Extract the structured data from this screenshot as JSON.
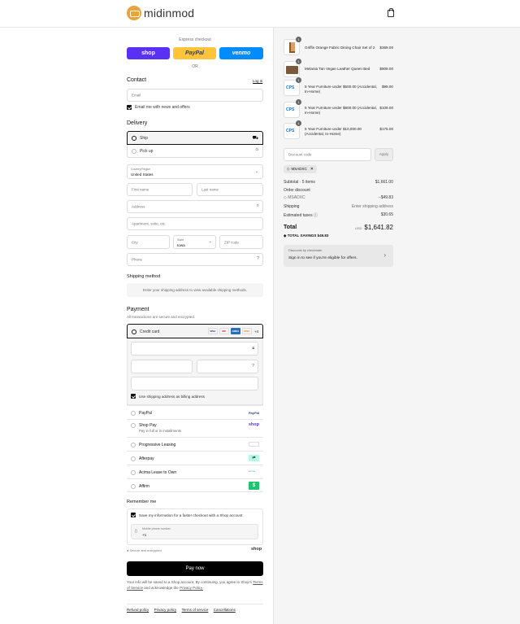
{
  "header": {
    "brand": "midinmod"
  },
  "express": {
    "label": "Express checkout",
    "shop": "shop",
    "paypal": "PayPal",
    "venmo": "venmo",
    "or": "OR"
  },
  "contact": {
    "title": "Contact",
    "login": "Log in",
    "email_placeholder": "Email",
    "news_label": "Email me with news and offers"
  },
  "delivery": {
    "title": "Delivery",
    "ship": "Ship",
    "pickup": "Pick up",
    "country_label": "Country/Region",
    "country_value": "United States",
    "first_name": "First name",
    "last_name": "Last name",
    "address": "Address",
    "apartment": "Apartment, suite, etc.",
    "city": "City",
    "state_label": "State",
    "state_value": "Iowa",
    "zip": "ZIP code",
    "phone": "Phone"
  },
  "shipping_method": {
    "title": "Shipping method",
    "note": "Enter your shipping address to view available shipping methods."
  },
  "payment": {
    "title": "Payment",
    "subtitle": "All transactions are secure and encrypted.",
    "credit_card": "Credit card",
    "more_cards": "+4",
    "card_brands": [
      "VISA",
      "MC",
      "AMEX",
      "DISC"
    ],
    "billing_label": "Use shipping address as billing address",
    "methods": [
      {
        "name": "PayPal",
        "badge": "PayPal"
      },
      {
        "name": "Shop Pay",
        "sub": "Pay in full or in installments",
        "badge": "shop"
      },
      {
        "name": "Progressive Leasing",
        "badge": ""
      },
      {
        "name": "Afterpay",
        "badge": ""
      },
      {
        "name": "Acima Lease to Own",
        "badge": ""
      },
      {
        "name": "Affirm",
        "badge": ""
      }
    ]
  },
  "remember": {
    "title": "Remember me",
    "save_label": "Save my information for a faster checkout with a Shop account",
    "phone_label": "Mobile phone number",
    "phone_value": "+1",
    "secure": "Secure and encrypted",
    "shop": "shop"
  },
  "pay_button": "Pay now",
  "legal": {
    "text": "Your info will be saved to a Shop account. By continuing, you agree to Shop's",
    "tos": "Terms of Service",
    "and": "and acknowledge the",
    "privacy": "Privacy Policy."
  },
  "footer": [
    "Refund policy",
    "Privacy policy",
    "Terms of service",
    "Cancellations"
  ],
  "cart": {
    "items": [
      {
        "name": "Griffin Orange Fabric Dining Chair Set of 2",
        "price": "$369.00",
        "qty": "1",
        "thumb": "chair"
      },
      {
        "name": "Melania Tan Vegan Leather Queen Bed",
        "price": "$909.00",
        "qty": "1",
        "thumb": "bed"
      },
      {
        "name": "5 Year Furniture under $500.00 (Accidental, In-Home)",
        "price": "$99.00",
        "qty": "1",
        "thumb": "CPS"
      },
      {
        "name": "5 Year Furniture under $800.00 (Accidental, In-Home)",
        "price": "$109.00",
        "qty": "1",
        "thumb": "CPS"
      },
      {
        "name": "5 Year Furniture under $10,000.00 (Accidental, In-Home)",
        "price": "$175.00",
        "qty": "1",
        "thumb": "CPS"
      }
    ],
    "discount_placeholder": "Discount code",
    "apply": "Apply",
    "code": "MSADXC",
    "subtotal_label": "Subtotal · 5 items",
    "subtotal": "$1,661.00",
    "order_discount": "Order discount",
    "discount_code": "MSADXC",
    "discount_value": "−$49.83",
    "shipping_label": "Shipping",
    "shipping_value": "Enter shipping address",
    "taxes_label": "Estimated taxes",
    "taxes_value": "$30.65",
    "total_label": "Total",
    "currency": "USD",
    "total": "$1,641.82",
    "savings_label": "TOTAL SAVINGS",
    "savings": "$49.83",
    "promo_top": "Discounts by checkmate.",
    "promo_text": "Sign in to see if you're eligible for offers."
  }
}
